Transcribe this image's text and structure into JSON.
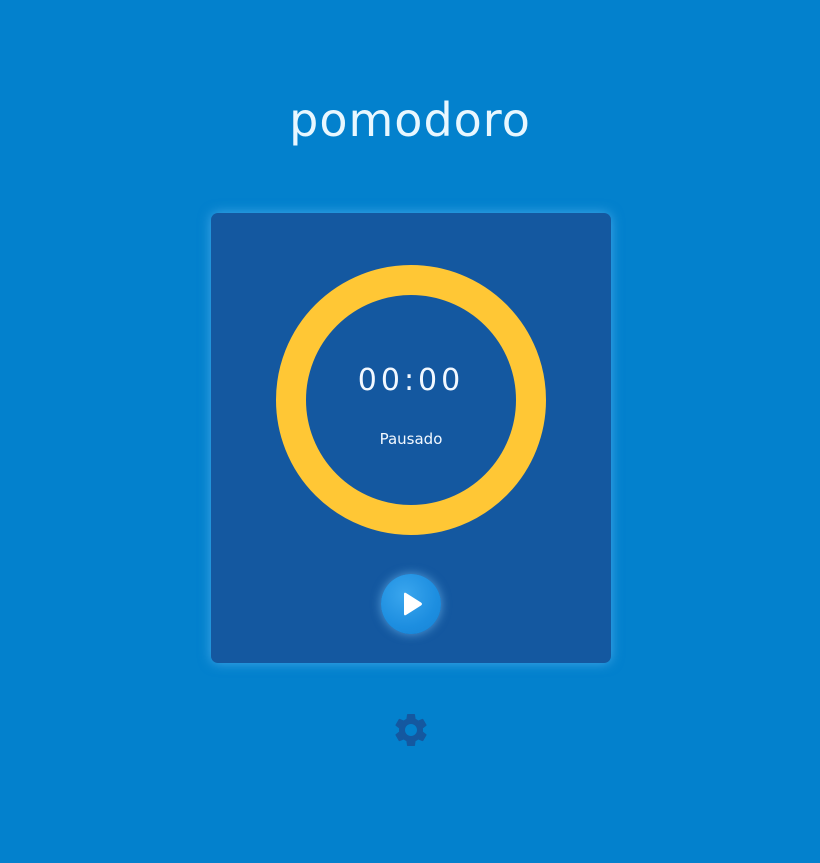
{
  "app": {
    "title": "pomodoro"
  },
  "timer": {
    "time": "00:00",
    "status": "Pausado",
    "progress_fraction": 1.0
  },
  "controls": {
    "play_icon": "play-icon",
    "settings_icon": "gear-icon"
  },
  "colors": {
    "background": "#0381cd",
    "card": "#1458a0",
    "ring": "#ffc735",
    "button": "#1d8ee0",
    "gear": "#1458a0",
    "text": "#f2f8ff"
  }
}
